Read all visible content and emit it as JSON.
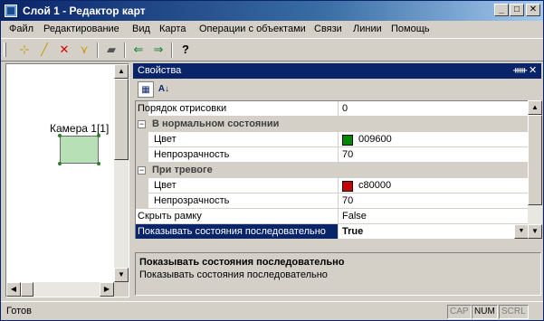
{
  "window": {
    "title": "Слой 1 - Редактор карт"
  },
  "menu": [
    "Файл",
    "Редактирование",
    "Вид",
    "Карта",
    "Операции с объектами",
    "Связи",
    "Линии",
    "Помощь"
  ],
  "toolbar": {
    "help": "?"
  },
  "canvas": {
    "camera_label": "Камера 1[1]"
  },
  "properties": {
    "title": "Свойства",
    "header_pin": "ᚔ",
    "header_close": "✕",
    "rows": [
      {
        "name": "Порядок отрисовки",
        "value": "0"
      },
      {
        "name": "В нормальном состоянии",
        "toggle": "−"
      },
      {
        "name": "Цвет",
        "value": "009600",
        "swatch": "#008a00"
      },
      {
        "name": "Непрозрачность",
        "value": "70"
      },
      {
        "name": "При тревоге",
        "toggle": "−"
      },
      {
        "name": "Цвет",
        "value": "c80000",
        "swatch": "#c80000"
      },
      {
        "name": "Непрозрачность",
        "value": "70"
      },
      {
        "name": "Скрыть рамку",
        "value": "False"
      },
      {
        "name": "Показывать состояния последовательно",
        "value": "True"
      }
    ],
    "description": {
      "title": "Показывать состояния последовательно",
      "text": "Показывать состояния последовательно"
    }
  },
  "status": {
    "text": "Готов",
    "cap": "CAP",
    "num": "NUM",
    "scrl": "SCRL"
  }
}
